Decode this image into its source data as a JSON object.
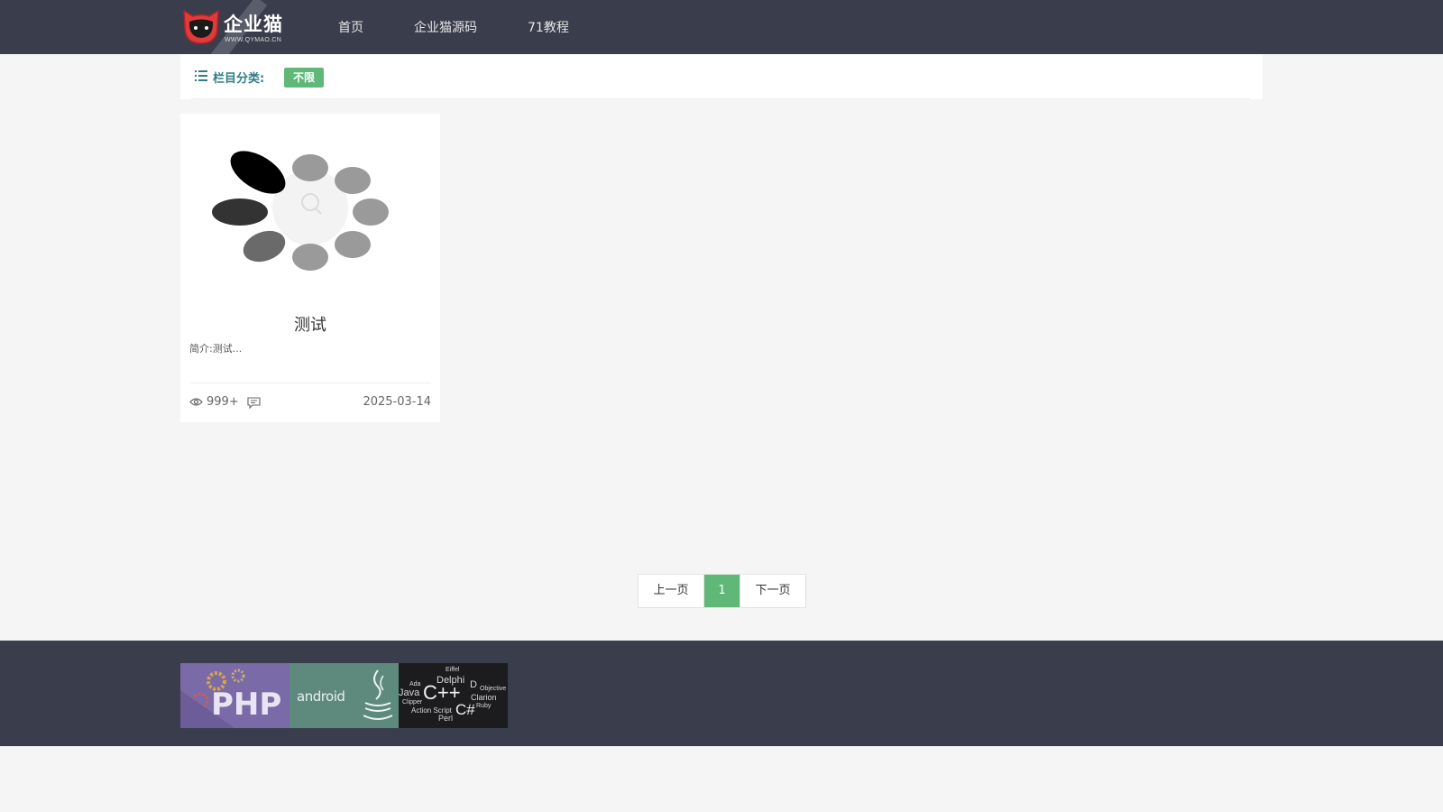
{
  "header": {
    "logo_text": "企业猫",
    "logo_sub": "WWW.QYMAO.CN",
    "nav": [
      {
        "label": "首页"
      },
      {
        "label": "企业猫源码"
      },
      {
        "label": "71教程"
      }
    ]
  },
  "category_bar": {
    "label": "栏目分类:",
    "tag": "不限"
  },
  "articles": [
    {
      "title": "测试",
      "summary": "简介:测试...",
      "views": "999+",
      "date": "2025-03-14"
    }
  ],
  "pagination": {
    "prev": "上一页",
    "current": "1",
    "next": "下一页"
  },
  "footer": {
    "banner": {
      "php": "PHP",
      "android": "android",
      "languages": [
        "Delphi",
        "Java",
        "C++",
        "C#",
        "Ada",
        "Clipper",
        "Action Script",
        "Perl",
        "Ruby",
        "Clarion",
        "Objective",
        "D",
        "Eiffel"
      ]
    }
  },
  "colors": {
    "header_bg": "#3a3e4c",
    "accent_green": "#5fb878",
    "category_label": "#2f7d83",
    "page_bg": "#f5f5f5"
  }
}
